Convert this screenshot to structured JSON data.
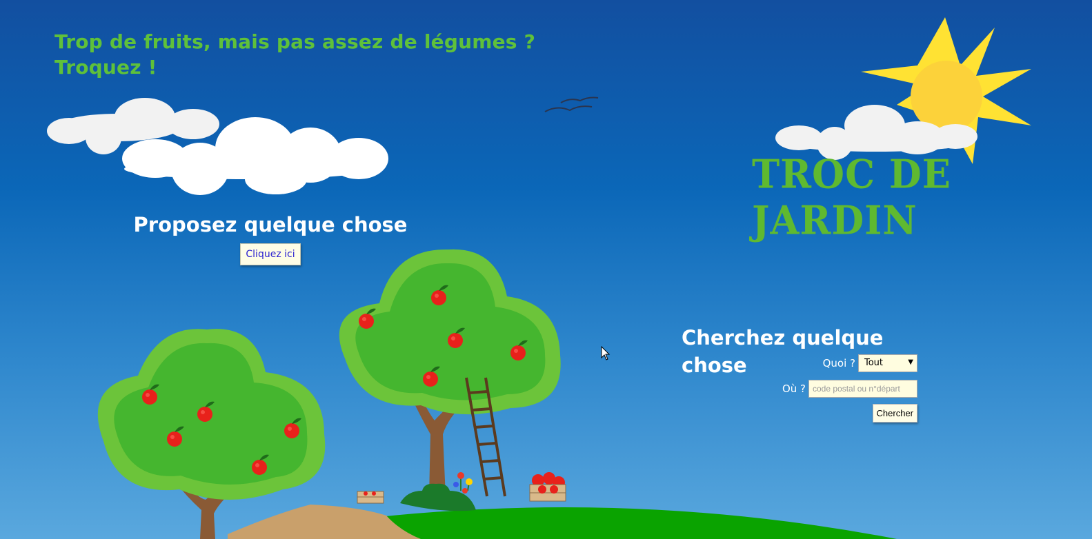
{
  "hero": {
    "tagline_line1": "Trop de fruits, mais pas assez de légumes ?",
    "tagline_line2": "Troquez !"
  },
  "logo": {
    "text": "TROC DE JARDIN"
  },
  "propose": {
    "title": "Proposez quelque chose",
    "button_label": "Cliquez ici"
  },
  "search": {
    "title": "Cherchez quelque chose",
    "what_label": "Quoi ?",
    "what_value": "Tout",
    "where_label": "Où ?",
    "where_placeholder": "code postal ou n°départ",
    "submit_label": "Chercher"
  },
  "colors": {
    "sky_top": "#124fa0",
    "sky_bottom": "#5aa8de",
    "brand_green": "#5fc13a",
    "button_bg": "#fffde6",
    "link_blue": "#2a1fd0",
    "apple_red": "#e8211b"
  },
  "icons": [
    "sun-icon",
    "cloud-icon",
    "birds-icon",
    "apple-tree-icon",
    "ladder-icon",
    "crate-icon",
    "flowers-icon",
    "cursor-icon"
  ]
}
